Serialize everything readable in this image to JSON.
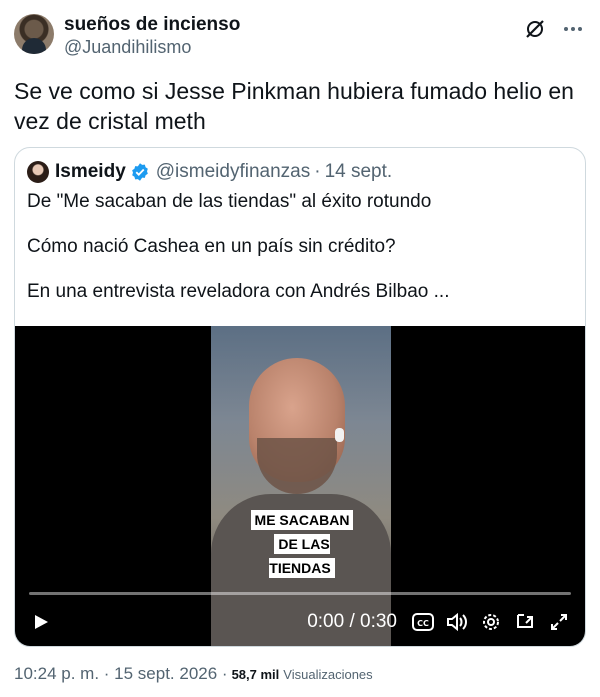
{
  "tweet": {
    "display_name": "sueños de incienso",
    "handle": "@Juandihilismo",
    "text": "Se ve como si Jesse Pinkman hubiera fumado helio en vez de cristal meth",
    "time": "10:24 p. m. · 15 sept. 2026 ·",
    "views_count": "58,7 mil",
    "views_label": "Visualizaciones"
  },
  "quote": {
    "display_name": "Ismeidy",
    "handle": "@ismeidyfinanzas",
    "separator": "·",
    "date": "14 sept.",
    "lines": [
      "De \"Me sacaban de las tiendas\" al éxito rotundo",
      "Cómo nació Cashea en un país sin crédito?",
      "En una entrevista reveladora con Andrés Bilbao ..."
    ]
  },
  "video": {
    "caption_line1": "ME SACABAN",
    "caption_line2": "DE LAS TIENDAS",
    "time": "0:00 / 0:30",
    "progress": 0.0
  },
  "colors": {
    "text": "#0f1419",
    "muted": "#536471",
    "border": "#cfd9de",
    "verified": "#1d9bf0"
  },
  "icons": [
    "grok-icon",
    "more-icon",
    "verified-icon",
    "play-icon",
    "captions-icon",
    "volume-icon",
    "settings-icon",
    "pip-icon",
    "fullscreen-icon"
  ]
}
